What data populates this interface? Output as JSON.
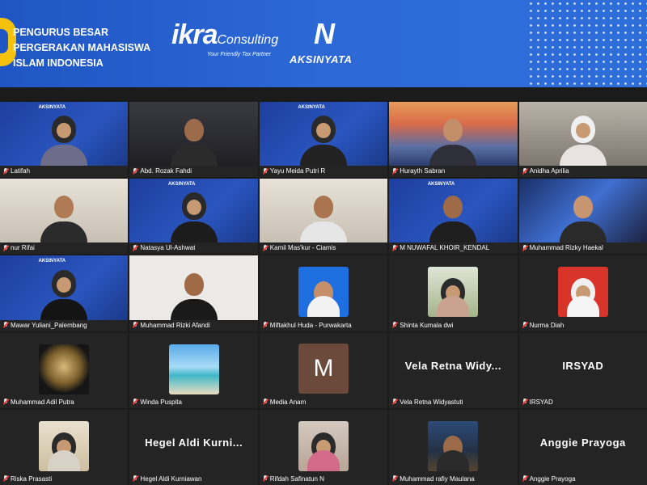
{
  "banner": {
    "org_lines": [
      "PENGURUS BESAR",
      "PERGERAKAN MAHASISWA",
      "ISLAM INDONESIA"
    ],
    "ikra_word": "ikra",
    "ikra_suffix": "Consulting",
    "ikra_tagline": "Your Friendly Tax Partner",
    "aksi_mark": "N",
    "aksi_word": "AKSINYATA"
  },
  "participants": [
    {
      "name": "Latifah",
      "scene": "banner",
      "person": "hijab",
      "skin": "#c99a74",
      "cloth": "#6d6d8a"
    },
    {
      "name": "Abd. Rozak Fahdi",
      "scene": "dark",
      "person": "plain",
      "skin": "#9c6b4b",
      "cloth": "#2b2b2b"
    },
    {
      "name": "Yayu Meida Putri R",
      "scene": "banner",
      "person": "hijab",
      "skin": "#bf8d67",
      "cloth": "#222"
    },
    {
      "name": "Hurayth Sabran",
      "scene": "sunset",
      "person": "plain",
      "skin": "#c28d69",
      "cloth": "#2f2f3a"
    },
    {
      "name": "Anidha Aprilia",
      "scene": "room",
      "person": "hijab",
      "skin": "#e1b896",
      "cloth": "#e8e2e0"
    },
    {
      "name": "nur Rifai",
      "scene": "wall",
      "person": "plain",
      "skin": "#b07a55",
      "cloth": "#2b2b2b"
    },
    {
      "name": "Natasya Ul-Ashwat",
      "scene": "banner",
      "person": "hijab",
      "skin": "#c7946e",
      "cloth": "#1c1c1c"
    },
    {
      "name": "Kamil Mas'kur - Ciamis",
      "scene": "wall",
      "person": "plain",
      "skin": "#a9744f",
      "cloth": "#e6e6e6"
    },
    {
      "name": "M NUWAFAL KHOIR_KENDAL",
      "scene": "banner",
      "person": "plain",
      "skin": "#9e6a48",
      "cloth": "#1e1e1e"
    },
    {
      "name": "Muhammad Rizky Haekal",
      "scene": "gaming",
      "person": "plain",
      "skin": "#c7956f",
      "cloth": "#2a2a2a"
    },
    {
      "name": "Mawar Yuliani_Palembang",
      "scene": "banner",
      "person": "hijab",
      "skin": "#c28e69",
      "cloth": "#141414"
    },
    {
      "name": "Muhammad Rizki Afandi",
      "scene": "white",
      "person": "plain",
      "skin": "#a06a47",
      "cloth": "#1a1a1a"
    },
    {
      "name": "Miftakhul Huda - Purwakarta",
      "scene": "blue",
      "person": "plain",
      "skin": "#c48f69",
      "cloth": "#f2f2f2",
      "small": true
    },
    {
      "name": "Shinta Kumala dwi",
      "scene": "green",
      "person": "hijab",
      "skin": "#d9ae8c",
      "cloth": "#c9a38f",
      "small": true
    },
    {
      "name": "Nurma Diah",
      "scene": "red",
      "person": "hijab",
      "skin": "#e4bc9b",
      "cloth": "#f5f5f5",
      "small": true
    },
    {
      "name": "Muhammad Adil Putra",
      "scene": "gold",
      "person": "none",
      "small": true
    },
    {
      "name": "Winda Puspita",
      "scene": "beach",
      "person": "none",
      "small": true
    },
    {
      "name": "Media Anam",
      "avatar": "M"
    },
    {
      "name": "Vela Retna Widyastuti",
      "display": "Vela Retna Widy..."
    },
    {
      "name": "IRSYAD",
      "display": "IRSYAD"
    },
    {
      "name": "Riska Prasasti",
      "scene": "cream",
      "person": "hijab",
      "skin": "#e3b894",
      "cloth": "#d8d1c6",
      "small": true
    },
    {
      "name": "Hegel Aldi Kurniawan",
      "display": "Hegel Aldi Kurni..."
    },
    {
      "name": "Rifdah Safinatun N",
      "scene": "pink",
      "person": "hijab",
      "skin": "#e6bd9d",
      "cloth": "#d46a8a",
      "small": true
    },
    {
      "name": "Muhammad rafiy Maulana",
      "scene": "night",
      "person": "plain",
      "skin": "#9b6a49",
      "cloth": "#2a2a2a",
      "small": true
    },
    {
      "name": "Anggie Prayoga",
      "display": "Anggie Prayoga"
    }
  ]
}
